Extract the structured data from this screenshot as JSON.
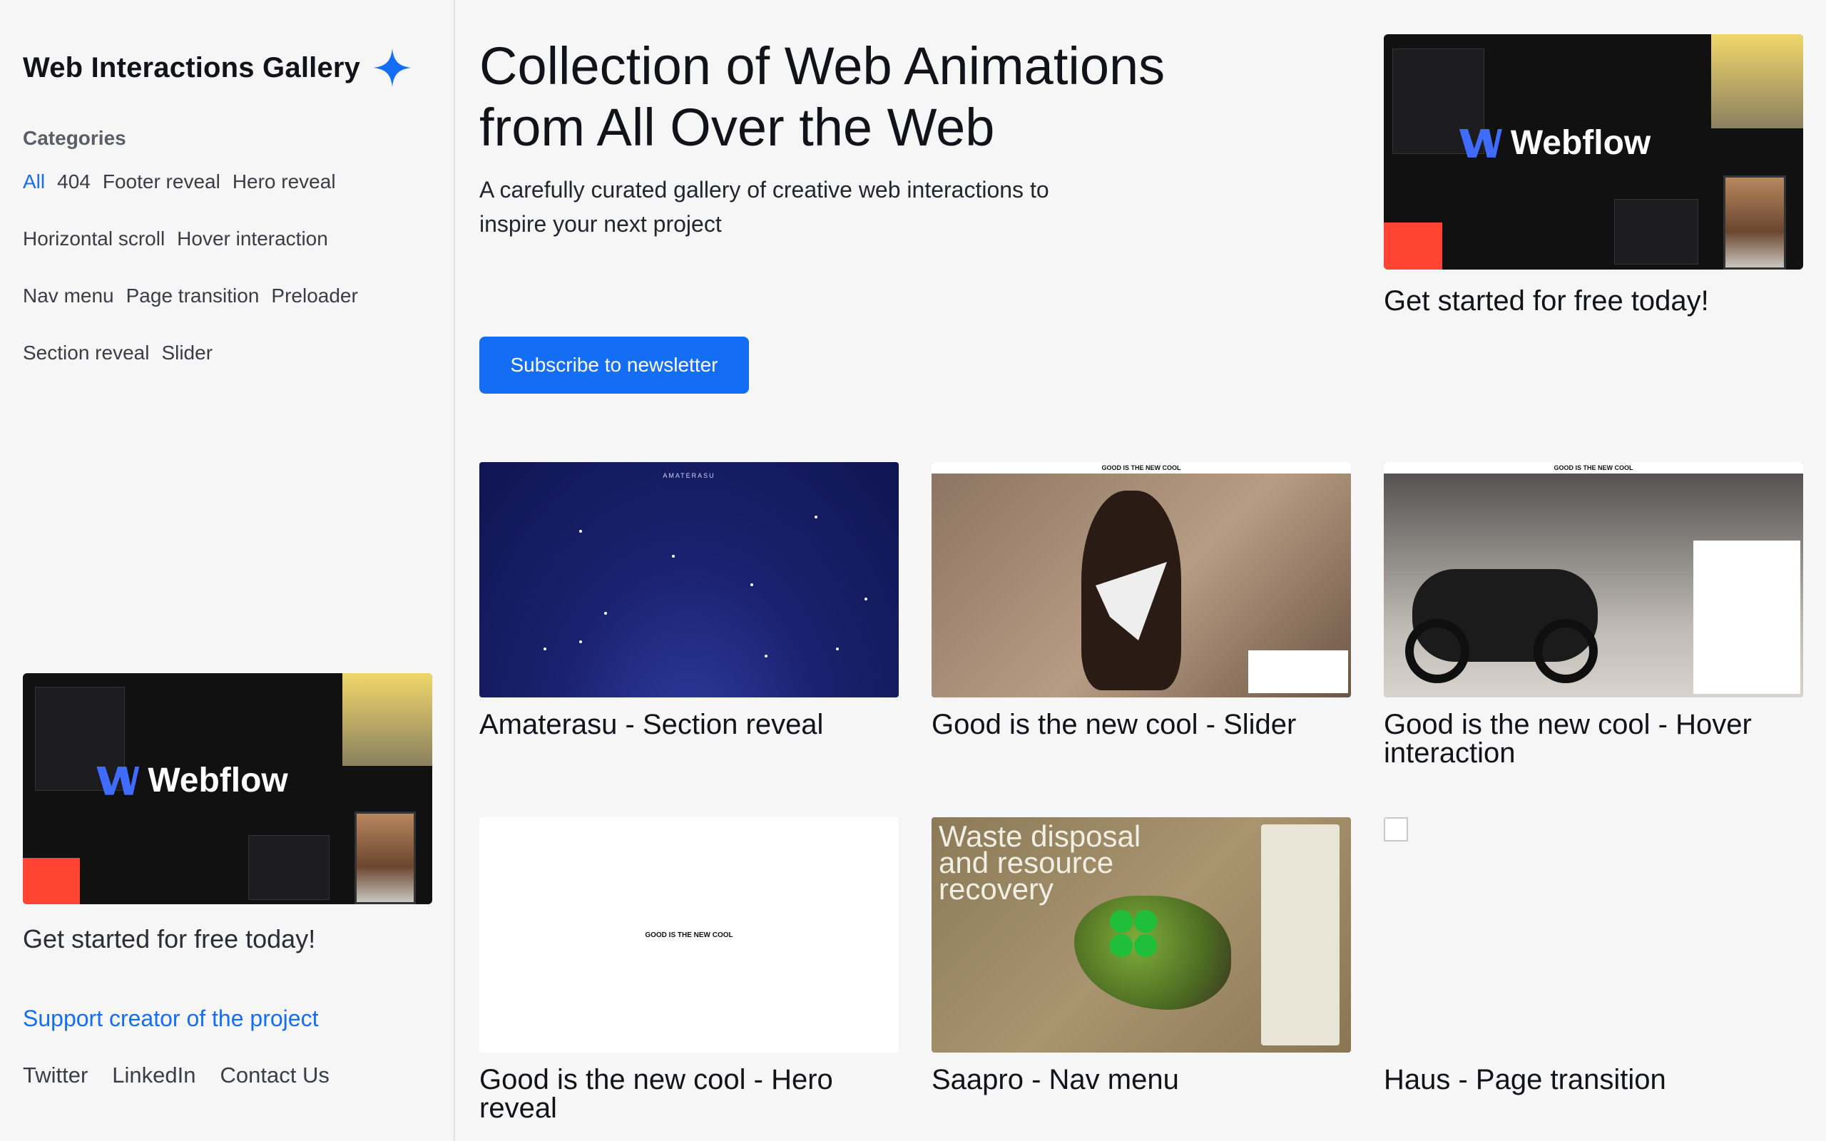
{
  "sidebar": {
    "brand": "Web Interactions Gallery",
    "categories_heading": "Categories",
    "categories": [
      "All",
      "404",
      "Footer reveal",
      "Hero reveal",
      "Horizontal scroll",
      "Hover interaction",
      "Nav menu",
      "Page transition",
      "Preloader",
      "Section reveal",
      "Slider"
    ],
    "active_category": "All",
    "promo": {
      "brand": "Webflow",
      "caption": "Get started for free today!"
    },
    "support_link": "Support creator of the project",
    "social": [
      "Twitter",
      "LinkedIn",
      "Contact Us"
    ]
  },
  "hero": {
    "title_line1": "Collection of Web Animations",
    "title_line2": "from All Over the Web",
    "subtitle_line1": "A carefully curated gallery of creative web interactions to",
    "subtitle_line2": "inspire your next project",
    "subscribe_label": "Subscribe to newsletter"
  },
  "top_promo": {
    "brand": "Webflow",
    "caption": "Get started for free today!"
  },
  "cards": [
    {
      "title": "Amaterasu - Section reveal",
      "thumb_text": "AMATERASU"
    },
    {
      "title": "Good is the new cool - Slider",
      "thumb_text": "GOOD IS THE NEW COOL"
    },
    {
      "title_line1": "Good is the new cool - Hover",
      "title_line2": "interaction",
      "thumb_text": "GOOD IS THE NEW COOL"
    },
    {
      "title_line1": "Good is the new cool - Hero",
      "title_line2": "reveal",
      "thumb_text": "GOOD IS THE NEW COOL"
    },
    {
      "title": "Saapro - Nav menu",
      "thumb_text_line1": "Waste disposal",
      "thumb_text_line2": "and resource",
      "thumb_text_line3": "recovery"
    },
    {
      "title": "Haus - Page transition"
    }
  ],
  "colors": {
    "accent": "#146ef5",
    "sparkle": "#146ef5",
    "background": "#f6f6f7"
  }
}
